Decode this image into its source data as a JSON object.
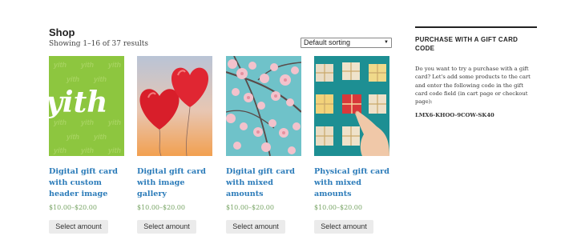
{
  "shop": {
    "title": "Shop",
    "result_count": "Showing 1–16 of 37 results",
    "sorting_selected": "Default sorting"
  },
  "products": [
    {
      "title": "Digital gift card with custom header image",
      "price": "$10.00–$20.00",
      "button": "Select amount",
      "image_text": "yith",
      "image_watermark": "yith"
    },
    {
      "title": "Digital gift card with image gallery",
      "price": "$10.00–$20.00",
      "button": "Select amount"
    },
    {
      "title": "Digital gift card with mixed amounts",
      "price": "$10.00–$20.00",
      "button": "Select amount"
    },
    {
      "title": "Physical gift card with mixed amounts",
      "price": "$10.00–$20.00",
      "button": "Select amount"
    }
  ],
  "sidebar": {
    "heading": "PURCHASE WITH A GIFT CARD CODE",
    "body": "Do you want to try a purchase with a gift card? Let's add some products to the cart and enter the following code in the gift card code field (in cart page or checkout page):",
    "code": "LMX6-KHOO-9COW-SK40"
  },
  "colors": {
    "link": "#2b7bb9",
    "price": "#77a464",
    "button_bg": "#ebebeb",
    "yith_green": "#8dc63f"
  }
}
